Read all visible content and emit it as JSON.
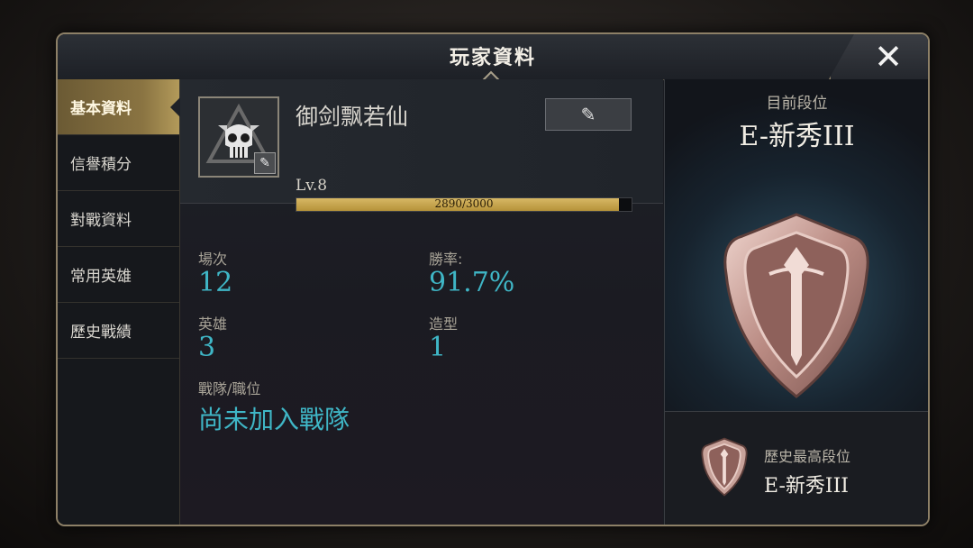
{
  "dialog": {
    "title": "玩家資料",
    "close_icon": "✕"
  },
  "sidebar": {
    "items": [
      {
        "label": "基本資料",
        "active": true
      },
      {
        "label": "信譽積分",
        "active": false
      },
      {
        "label": "對戰資料",
        "active": false
      },
      {
        "label": "常用英雄",
        "active": false
      },
      {
        "label": "歷史戰績",
        "active": false
      }
    ]
  },
  "profile": {
    "name": "御剑飘若仙",
    "level": "Lv.8",
    "xp_text": "2890/3000",
    "xp_fraction": 0.9633,
    "rename_icon": "✎",
    "avatar_edit_icon": "✎"
  },
  "stats": {
    "matches_label": "場次",
    "matches_value": "12",
    "winrate_label": "勝率:",
    "winrate_value": "91.7%",
    "heroes_label": "英雄",
    "heroes_value": "3",
    "skins_label": "造型",
    "skins_value": "1",
    "team_label": "戰隊/職位",
    "team_value": "尚未加入戰隊"
  },
  "rank": {
    "current_label": "目前段位",
    "current_name": "E-新秀III",
    "history_label": "歷史最高段位",
    "history_name": "E-新秀III"
  },
  "colors": {
    "accent_teal": "#3fb6c6",
    "gold": "#b59239",
    "shield": "#c8a29a"
  }
}
